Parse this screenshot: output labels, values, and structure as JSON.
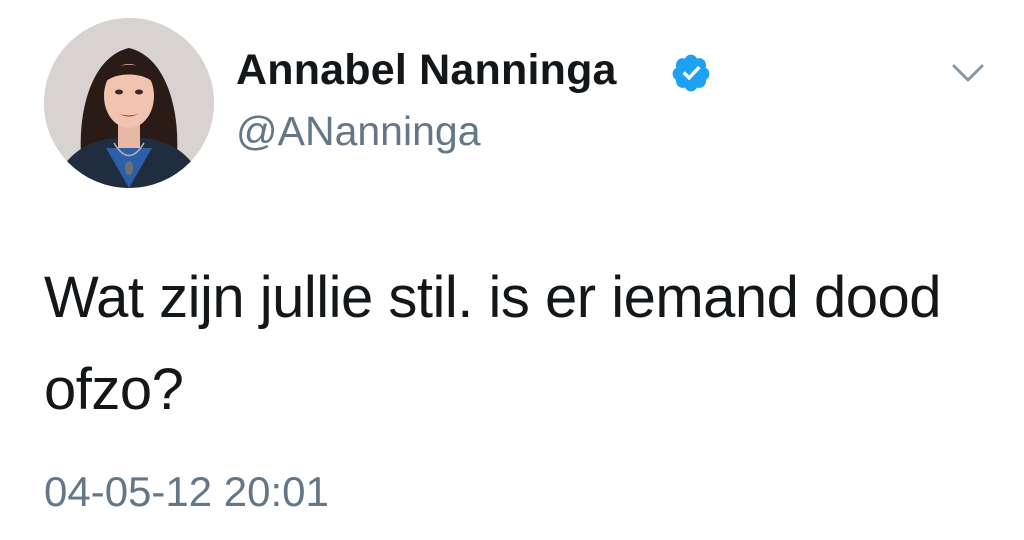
{
  "user": {
    "display_name": "Annabel Nanninga",
    "handle": "@ANanninga",
    "verified": true,
    "verified_icon": "verified-badge-icon",
    "avatar_icon": "profile-photo"
  },
  "tweet": {
    "text": "Wat zijn jullie stil. is er iemand dood ofzo?",
    "timestamp": "04-05-12 20:01"
  },
  "menu": {
    "icon": "chevron-down-icon"
  },
  "colors": {
    "verified_blue": "#1da1f2",
    "text_primary": "#14171a",
    "text_secondary": "#657786",
    "chevron": "#8899a6"
  }
}
